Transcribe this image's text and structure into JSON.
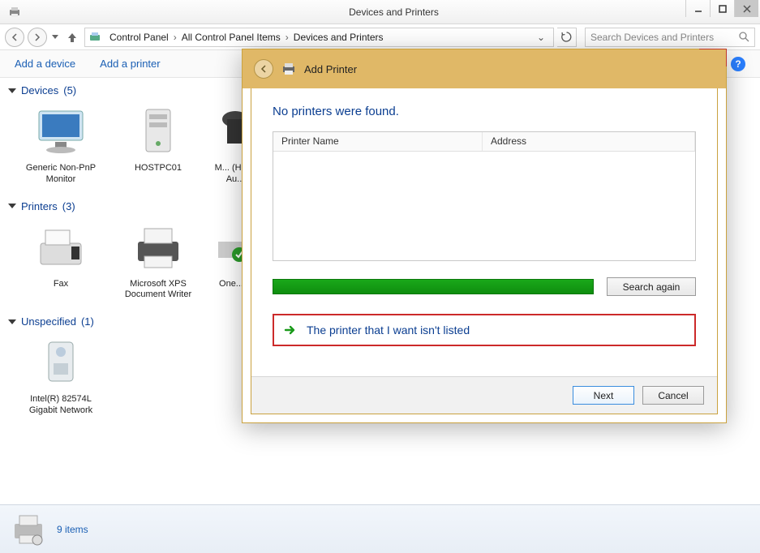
{
  "window": {
    "title": "Devices and Printers"
  },
  "breadcrumb": {
    "items": [
      "Control Panel",
      "All Control Panel Items",
      "Devices and Printers"
    ]
  },
  "search": {
    "placeholder": "Search Devices and Printers"
  },
  "toolbar": {
    "add_device": "Add a device",
    "add_printer": "Add a printer"
  },
  "sections": {
    "devices": {
      "label": "Devices",
      "count": "(5)"
    },
    "printers": {
      "label": "Printers",
      "count": "(3)"
    },
    "unspecified": {
      "label": "Unspecified",
      "count": "(1)"
    }
  },
  "devices": [
    {
      "label": "Generic Non-PnP Monitor"
    },
    {
      "label": "HOSTPC01"
    },
    {
      "label": "M... (Hig... Au..."
    }
  ],
  "printers": [
    {
      "label": "Fax"
    },
    {
      "label": "Microsoft XPS Document Writer"
    },
    {
      "label": "One..."
    }
  ],
  "unspecified": [
    {
      "label": "Intel(R) 82574L Gigabit Network"
    }
  ],
  "status": {
    "count_text": "9 items"
  },
  "dialog": {
    "title": "Add Printer",
    "message": "No printers were found.",
    "columns": {
      "name": "Printer Name",
      "address": "Address"
    },
    "search_again": "Search again",
    "not_listed": "The printer that I want isn't listed",
    "next": "Next",
    "cancel": "Cancel"
  }
}
